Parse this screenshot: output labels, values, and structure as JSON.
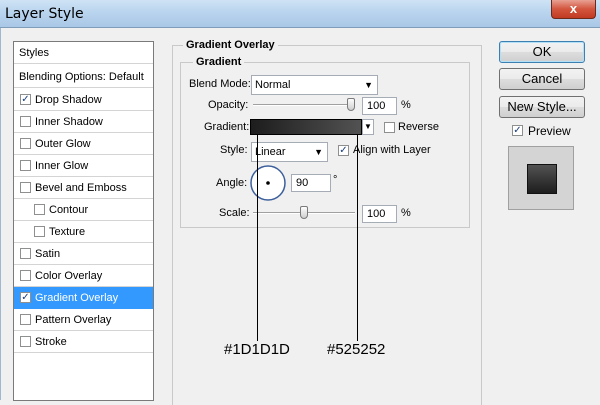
{
  "window": {
    "title": "Layer Style",
    "close_glyph": "x"
  },
  "sidebar": {
    "header": "Styles",
    "blending": "Blending Options: Default",
    "items": [
      {
        "label": "Drop Shadow",
        "checked": true
      },
      {
        "label": "Inner Shadow",
        "checked": false
      },
      {
        "label": "Outer Glow",
        "checked": false
      },
      {
        "label": "Inner Glow",
        "checked": false
      },
      {
        "label": "Bevel and Emboss",
        "checked": false
      },
      {
        "label": "Contour",
        "checked": false
      },
      {
        "label": "Texture",
        "checked": false
      },
      {
        "label": "Satin",
        "checked": false
      },
      {
        "label": "Color Overlay",
        "checked": false
      },
      {
        "label": "Gradient Overlay",
        "checked": true
      },
      {
        "label": "Pattern Overlay",
        "checked": false
      },
      {
        "label": "Stroke",
        "checked": false
      }
    ]
  },
  "panel": {
    "title": "Gradient Overlay",
    "group": "Gradient",
    "blend_mode_label": "Blend Mode:",
    "blend_mode_value": "Normal",
    "opacity_label": "Opacity:",
    "opacity_value": "100",
    "opacity_unit": "%",
    "opacity_level": 1.0,
    "gradient_label": "Gradient:",
    "reverse_label": "Reverse",
    "reverse_checked": false,
    "style_label": "Style:",
    "style_value": "Linear",
    "align_label": "Align with Layer",
    "align_checked": true,
    "angle_label": "Angle:",
    "angle_value": "90",
    "angle_unit": "°",
    "scale_label": "Scale:",
    "scale_value": "100",
    "scale_unit": "%",
    "scale_level": 0.5
  },
  "buttons": {
    "ok": "OK",
    "cancel": "Cancel",
    "new_style": "New Style...",
    "preview": "Preview",
    "preview_checked": true
  },
  "annotations": {
    "left_color": "#1D1D1D",
    "right_color": "#525252"
  },
  "colors": {
    "gradient_start": "#1D1D1D",
    "gradient_end": "#525252",
    "selection": "#3399FF"
  }
}
